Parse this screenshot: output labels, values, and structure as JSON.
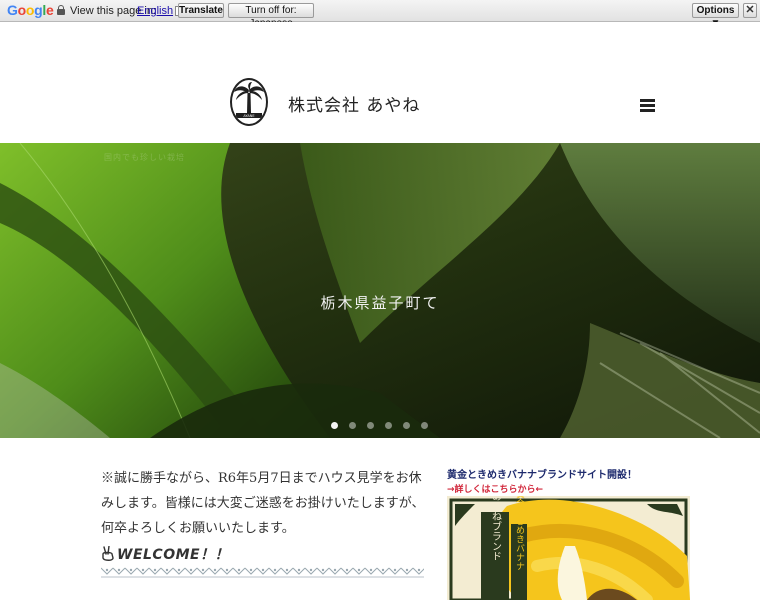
{
  "translate_bar": {
    "logo": "Google",
    "label": "View this page in:",
    "language": "English",
    "translate_button": "Translate",
    "turn_off_button": "Turn off for: Japanese",
    "options_button": "Options ▼",
    "close_button": "✕"
  },
  "header": {
    "brand_name": "株式会社 あやね",
    "logo_text": "AYANE"
  },
  "hero": {
    "caption": "栃木県益子町て",
    "faint_text": "国内でも珍しい栽培",
    "slides": 6,
    "active_slide": 1
  },
  "content": {
    "notice": "※誠に勝手ながら、R6年5月7日までハウス見学をお休みします。皆様には大変ご迷惑をお掛けいたしますが、何卒よろしくお願いいたします。",
    "welcome": "WELCOME！！"
  },
  "sidebar": {
    "brand_title": "黄金ときめきバナナブランドサイト開設！",
    "brand_link": "→詳しくはこちらから←",
    "banner_vertical_1": "あやねブランド",
    "banner_vertical_2": "黄金ときめきバナナ"
  },
  "colors": {
    "brand_title": "#1e2b6e",
    "brand_link": "#d1263a"
  }
}
